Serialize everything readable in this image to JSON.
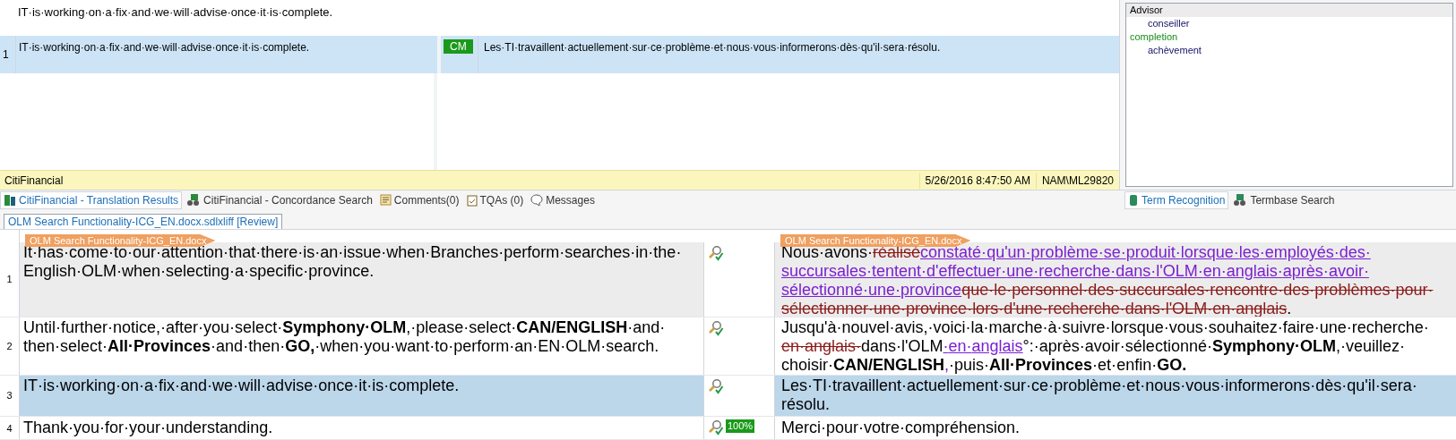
{
  "active_source": "IT·is·working·on·a·fix·and·we·will·advise·once·it·is·complete.",
  "translation_results": [
    {
      "number": "1",
      "source": "IT·is·working·on·a·fix·and·we·will·advise·once·it·is·complete.",
      "badge": "CM",
      "target": "Les·TI·travaillent·actuellement·sur·ce·problème·et·nous·vous·informerons·dès·qu'il·sera·résolu.",
      "selected": true
    }
  ],
  "info_bar": {
    "memory": "CitiFinancial",
    "date": "5/26/2016 8:47:50 AM",
    "user": "NAM\\ML29820"
  },
  "terms": [
    {
      "source": "Advisor",
      "selected": true,
      "translations": [
        "conseiller"
      ]
    },
    {
      "source": "completion",
      "selected": false,
      "translations": [
        "achèvement"
      ]
    }
  ],
  "bottom_tabs": [
    {
      "label": "CitiFinancial - Translation Results",
      "selected": true,
      "kind": "results"
    },
    {
      "label": "CitiFinancial - Concordance Search",
      "selected": false,
      "kind": "concordance"
    },
    {
      "label": "Comments(0)",
      "selected": false,
      "kind": "comments"
    },
    {
      "label": "TQAs (0)",
      "selected": false,
      "kind": "tqa"
    },
    {
      "label": "Messages",
      "selected": false,
      "kind": "messages"
    }
  ],
  "term_tabs": [
    {
      "label": "Term Recognition",
      "selected": true,
      "kind": "recognition"
    },
    {
      "label": "Termbase Search",
      "selected": false,
      "kind": "search"
    }
  ],
  "document_tab": "OLM Search Functionality-ICG_EN.docx.sdlxliff [Review]",
  "source_file_tag": "OLM Search Functionality-ICG_EN.docx",
  "target_file_tag": "OLM Search Functionality-ICG_EN.docx",
  "segments": [
    {
      "number": "1",
      "selected": false,
      "shaded": true,
      "source": "It·has·come·to·our·attention·that·there·is·an·issue·when·Branches·perform·searches·in·the·English·OLM·when·selecting·a·specific·province.",
      "target": [
        {
          "kind": "plain",
          "text": "Nous·avons·"
        },
        {
          "kind": "deleted",
          "text": "réalisé"
        },
        {
          "kind": "inserted",
          "text": "constaté·qu'un·problème·se·produit·lorsque·les·employés·des·succursales·tentent·d'effectuer·une·recherche·dans·l'OLM·en·anglais·après·avoir·sélectionné·une·province"
        },
        {
          "kind": "deleted",
          "text": "que·le·personnel·des·succursales·rencontre·des·problèmes·pour·sélectionner·une·province·lors·d'une·recherche·dans·l'OLM·en·anglais"
        },
        {
          "kind": "plain",
          "text": "."
        }
      ]
    },
    {
      "number": "2",
      "selected": false,
      "shaded": false,
      "source": "Until·further·notice,·after·you·select·**Symphony·OLM**,·please·select·**CAN/ENGLISH**·and·then·select·**All·Provinces**·and·then·**GO,**·when·you·want·to·perform·an·EN·OLM·search.",
      "target": [
        {
          "kind": "plain",
          "text": "Jusqu'à·nouvel·avis,·voici·la·marche·à·suivre·lorsque·vous·souhaitez·faire·une·recherche·"
        },
        {
          "kind": "deleted",
          "text": "en·anglais·"
        },
        {
          "kind": "plain",
          "text": "dans·l'OLM"
        },
        {
          "kind": "inserted",
          "text": "·en·anglais"
        },
        {
          "kind": "plain",
          "text": "°:·après·avoir·sélectionné·"
        },
        {
          "kind": "bold",
          "text": "Symphony·OLM"
        },
        {
          "kind": "plain",
          "text": ",·veuillez·"
        },
        {
          "kind": "plain",
          "text": "choisir·"
        },
        {
          "kind": "bold",
          "text": "CAN/ENGLISH"
        },
        {
          "kind": "inserted",
          "text": ","
        },
        {
          "kind": "plain",
          "text": "·puis·"
        },
        {
          "kind": "bold",
          "text": "All·Provinces"
        },
        {
          "kind": "plain",
          "text": "·et·enfin·"
        },
        {
          "kind": "bold",
          "text": "GO."
        }
      ]
    },
    {
      "number": "3",
      "selected": true,
      "shaded": false,
      "source": "IT·is·working·on·a·fix·and·we·will·advise·once·it·is·complete.",
      "target": [
        {
          "kind": "plain",
          "text": "Les·TI·travaillent·actuellement·sur·ce·problème·et·nous·vous·informerons·dès·qu'il·sera·résolu."
        }
      ]
    },
    {
      "number": "4",
      "selected": false,
      "shaded": false,
      "source": "Thank·you·for·your·understanding.",
      "match": "100%",
      "target": [
        {
          "kind": "plain",
          "text": "Merci·pour·votre·compréhension."
        }
      ]
    }
  ]
}
